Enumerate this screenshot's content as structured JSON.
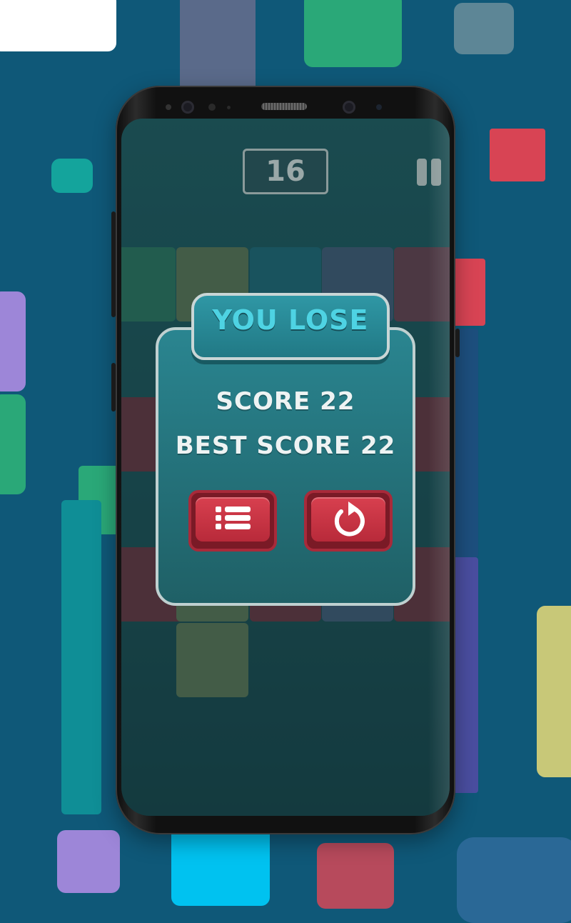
{
  "game": {
    "current_score": "16",
    "dialog": {
      "title": "YOU LOSE",
      "score_label": "SCORE",
      "score_value": "22",
      "best_label": "BEST SCORE",
      "best_value": "22",
      "buttons": [
        {
          "name": "menu",
          "icon": "list-menu-icon"
        },
        {
          "name": "restart",
          "icon": "restart-icon"
        }
      ]
    }
  },
  "colors": {
    "background": "#0f5878",
    "panel": "#25747d",
    "title_text": "#4ed3e3",
    "button_red": "#c93444",
    "tile_colors": [
      "#2aa878",
      "#d84454",
      "#9d86d8",
      "#14b8b0",
      "#c8c878",
      "#00c2f0",
      "#5a6a9a"
    ]
  }
}
